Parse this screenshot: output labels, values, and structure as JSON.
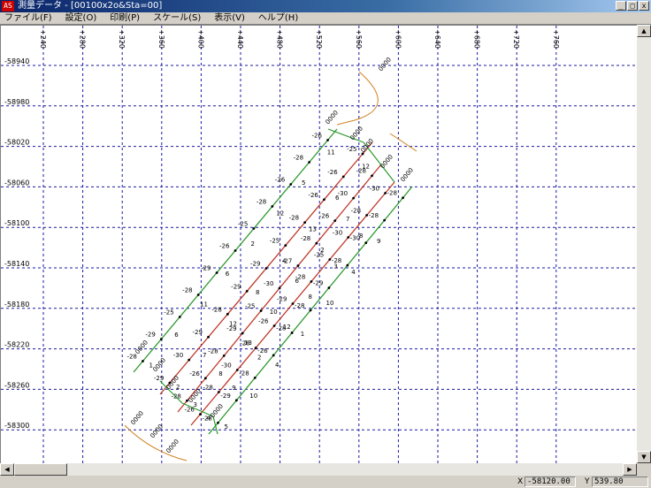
{
  "window": {
    "app_icon": "AS",
    "title": "測量データ - [00100x2o&Sta=00]",
    "buttons": [
      "_",
      "□",
      "x"
    ]
  },
  "menu": {
    "items": [
      "ファイル(F)",
      "設定(O)",
      "印刷(P)",
      "スケール(S)",
      "表示(V)",
      "ヘルプ(H)"
    ]
  },
  "plot": {
    "x_ticks": [
      "+240",
      "+280",
      "+320",
      "+360",
      "+400",
      "+440",
      "+480",
      "+520",
      "+560",
      "+600",
      "+640",
      "+680",
      "+720",
      "+760"
    ],
    "y_ticks": [
      "-58940",
      "-58980",
      "-58020",
      "-58060",
      "-58100",
      "-58140",
      "-58180",
      "-58220",
      "-58260",
      "-58300"
    ],
    "point_labels": [
      "-28",
      "-29",
      "-25",
      "-28",
      "-29",
      "-26",
      "-25",
      "-28",
      "-26",
      "-28",
      "-26",
      "-29",
      "-30",
      "-29",
      "-28",
      "-29",
      "-29",
      "-25",
      "-28",
      "-26",
      "-26",
      "-25",
      "-28",
      "-26",
      "-28",
      "-29",
      "-25",
      "-30",
      "-27",
      "-28",
      "-26",
      "-30",
      "-28",
      "-26",
      "-28",
      "-30",
      "-28",
      "-26",
      "-29",
      "-28",
      "-25",
      "-30",
      "-28",
      "-30",
      "-28",
      "-29",
      "-28",
      "-26",
      "-28",
      "-28",
      "-29",
      "-28",
      "-30",
      "-28",
      "-28",
      "-29"
    ],
    "station_numbers": [
      "1",
      "2",
      "3",
      "4",
      "5",
      "6",
      "7",
      "8",
      "9",
      "10",
      "11",
      "12",
      "13",
      "2",
      "4",
      "6",
      "8",
      "10",
      "12",
      "1",
      "2",
      "4",
      "6",
      "8",
      "10",
      "12",
      "13",
      "2",
      "3",
      "4",
      "5",
      "6",
      "7",
      "8",
      "9",
      "11",
      "12"
    ],
    "box_labels": [
      "0000",
      "0000",
      "0000",
      "0000",
      "0000",
      "0000",
      "0000",
      "0000",
      "0000",
      "0000",
      "0000",
      "0000",
      "0000",
      "0000"
    ]
  },
  "status": {
    "x_label": "X",
    "x_value": "-58120.00",
    "y_label": "Y",
    "y_value": "539.80"
  },
  "colors": {
    "grid": "#1a1aa0",
    "survey_line_a": "#2d9a2d",
    "survey_line_b": "#c0392b",
    "boundary": "#d08020"
  }
}
